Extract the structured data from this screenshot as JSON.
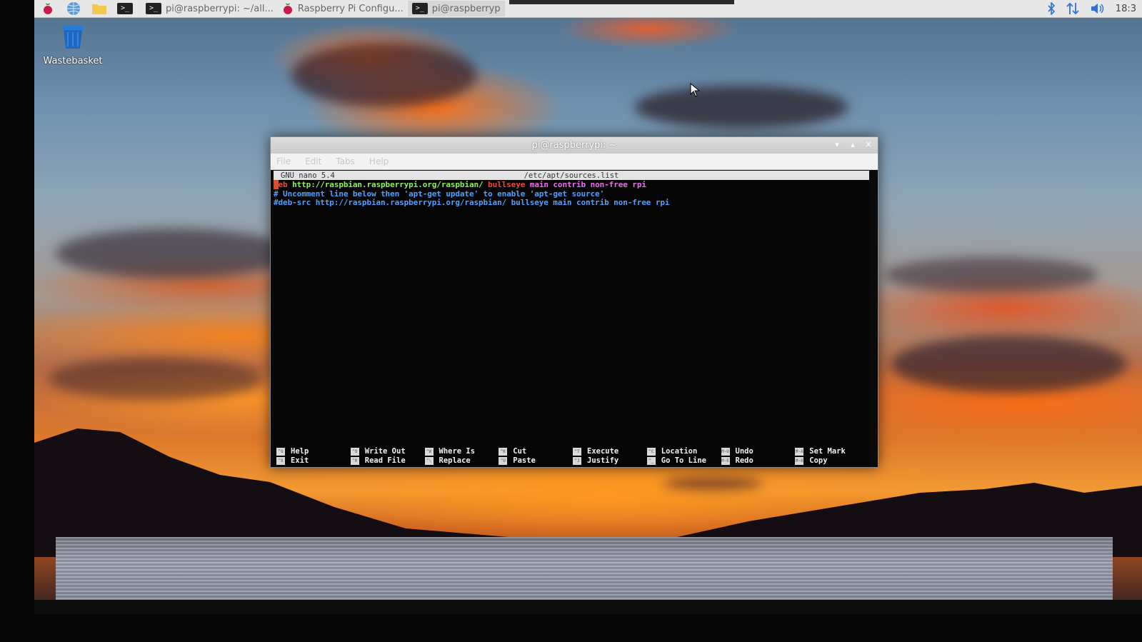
{
  "taskbar": {
    "tasks": [
      {
        "label": "pi@raspberrypi: ~/all...",
        "icon": "terminal-icon",
        "active": false
      },
      {
        "label": "Raspberry Pi Configu...",
        "icon": "raspberry-icon",
        "active": false
      },
      {
        "label": "pi@raspberryp",
        "icon": "terminal-icon",
        "active": true
      }
    ],
    "clock": "18:3"
  },
  "desktop": {
    "wastebasket_label": "Wastebasket"
  },
  "terminal": {
    "title": "pi@raspberrypi: ~",
    "menu": [
      "File",
      "Edit",
      "Tabs",
      "Help"
    ],
    "nano": {
      "version": "GNU nano 5.4",
      "filename": "/etc/apt/sources.list",
      "line1": {
        "cursor": "d",
        "keyword": "eb",
        "url": "http://raspbian.raspberrypi.org/raspbian/",
        "suite": "bullseye",
        "components": "main contrib non-free rpi"
      },
      "line2": "# Uncomment line below then 'apt-get update' to enable 'apt-get source'",
      "line3": "#deb-src http://raspbian.raspberrypi.org/raspbian/ bullseye main contrib non-free rpi"
    },
    "shortcuts": [
      {
        "key1": "^G",
        "label1": "Help",
        "key2": "^X",
        "label2": "Exit"
      },
      {
        "key1": "^O",
        "label1": "Write Out",
        "key2": "^R",
        "label2": "Read File"
      },
      {
        "key1": "^W",
        "label1": "Where Is",
        "key2": "^\\",
        "label2": "Replace"
      },
      {
        "key1": "^K",
        "label1": "Cut",
        "key2": "^U",
        "label2": "Paste"
      },
      {
        "key1": "^T",
        "label1": "Execute",
        "key2": "^J",
        "label2": "Justify"
      },
      {
        "key1": "^C",
        "label1": "Location",
        "key2": "^_",
        "label2": "Go To Line"
      },
      {
        "key1": "M-U",
        "label1": "Undo",
        "key2": "M-E",
        "label2": "Redo"
      },
      {
        "key1": "M-A",
        "label1": "Set Mark",
        "key2": "M-6",
        "label2": "Copy"
      }
    ]
  }
}
